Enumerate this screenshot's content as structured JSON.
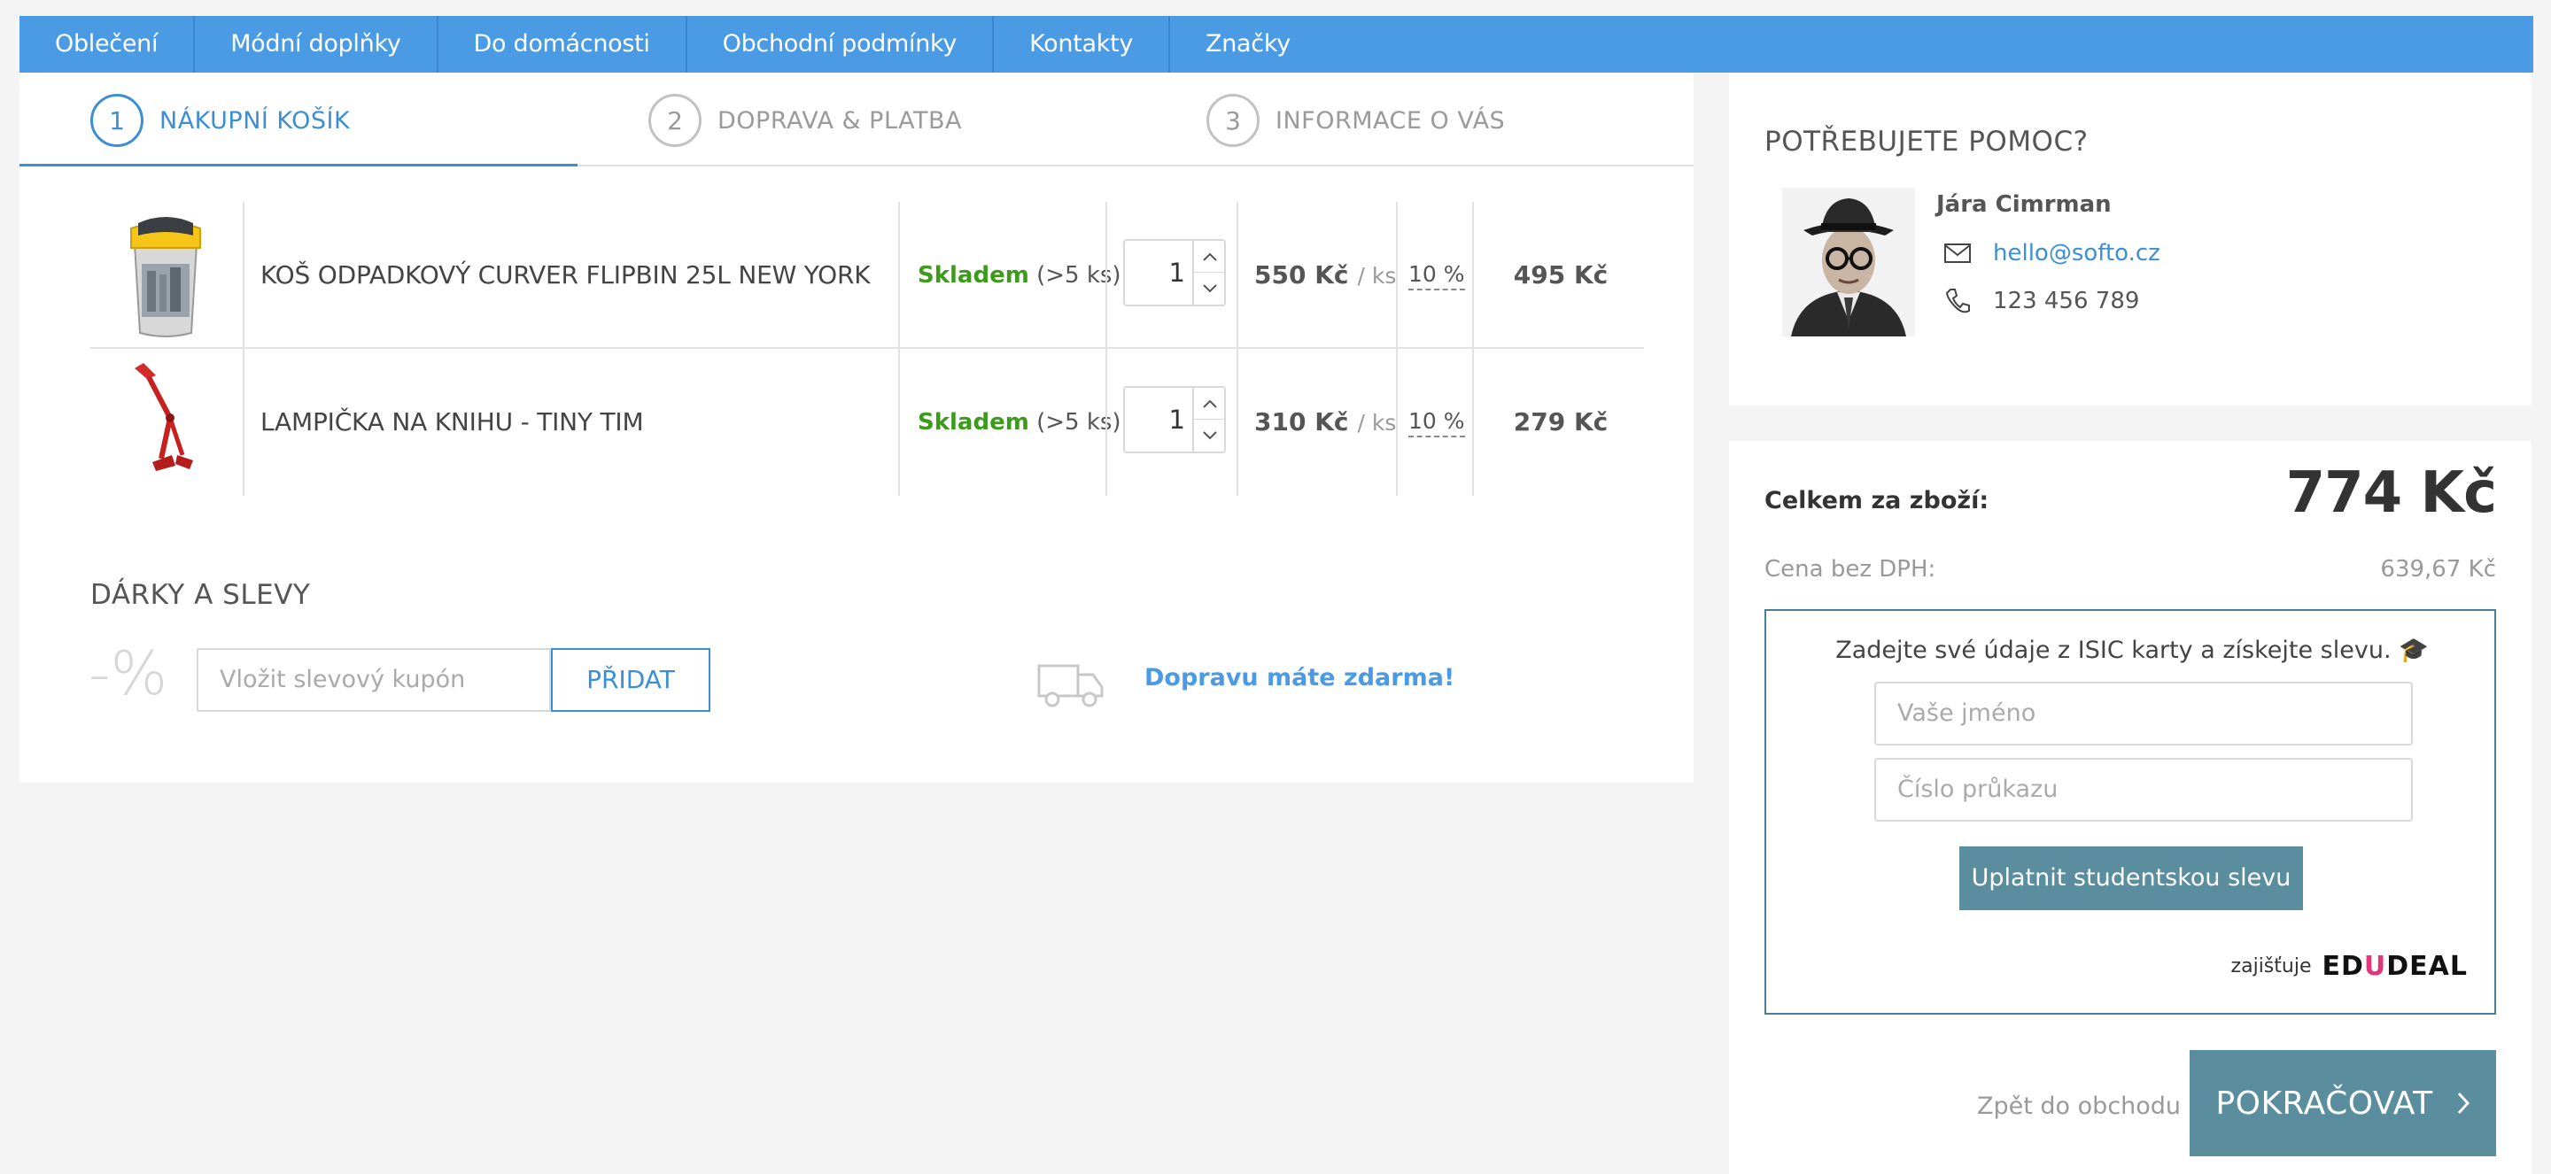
{
  "nav": {
    "items": [
      {
        "label": "Oblečení"
      },
      {
        "label": "Módní doplňky"
      },
      {
        "label": "Do domácnosti"
      },
      {
        "label": "Obchodní podmínky"
      },
      {
        "label": "Kontakty"
      },
      {
        "label": "Značky"
      }
    ]
  },
  "steps": [
    {
      "number": "1",
      "label": "NÁKUPNÍ KOŠÍK",
      "active": true
    },
    {
      "number": "2",
      "label": "DOPRAVA & PLATBA",
      "active": false
    },
    {
      "number": "3",
      "label": "INFORMACE O VÁS",
      "active": false
    }
  ],
  "cart": {
    "items": [
      {
        "name": "KOŠ ODPADKOVÝ CURVER FLIPBIN 25L NEW YORK",
        "stock_status": "Skladem",
        "stock_count": "(>5 ks)",
        "quantity": "1",
        "unit_price": "550 Kč",
        "unit_suffix": "/ ks",
        "vat": "10 %",
        "total": "495 Kč"
      },
      {
        "name": "LAMPIČKA NA KNIHU - TINY TIM",
        "stock_status": "Skladem",
        "stock_count": "(>5 ks)",
        "quantity": "1",
        "unit_price": "310 Kč",
        "unit_suffix": "/ ks",
        "vat": "10 %",
        "total": "279 Kč"
      }
    ]
  },
  "gifts": {
    "title": "DÁRKY A SLEVY",
    "percent_symbol": "-%",
    "coupon_placeholder": "Vložit slevový kupón",
    "add_button": "PŘIDAT",
    "free_shipping": "Dopravu máte zdarma!"
  },
  "help": {
    "title": "POTŘEBUJETE POMOC?",
    "name": "Jára Cimrman",
    "email": "hello@softo.cz",
    "phone": "123 456 789"
  },
  "summary": {
    "total_label": "Celkem za zboží:",
    "total_value": "774 Kč",
    "novat_label": "Cena bez DPH:",
    "novat_value": "639,67 Kč"
  },
  "isic": {
    "text": "Zadejte své údaje z ISIC karty a získejte slevu. 🎓",
    "name_placeholder": "Vaše jméno",
    "card_placeholder": "Číslo průkazu",
    "button": "Uplatnit studentskou slevu",
    "provided_by": "zajišťuje",
    "logo_part1": "ED",
    "logo_part2": "U",
    "logo_part3": "DEAL"
  },
  "actions": {
    "back": "Zpět do obchodu",
    "continue": "POKRAČOVAT"
  },
  "colors": {
    "accent": "#4a9be3",
    "in_stock": "#3d9b1c",
    "button_teal": "#5a8e9e"
  }
}
